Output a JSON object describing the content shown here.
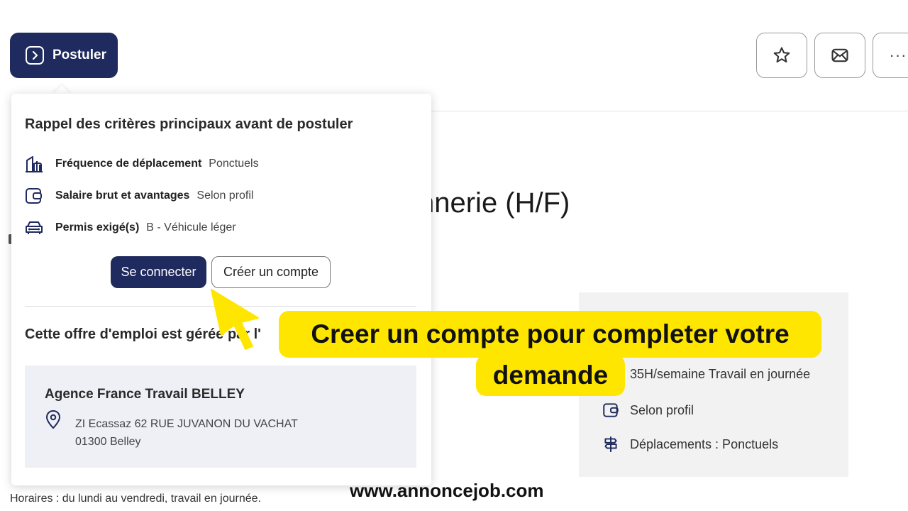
{
  "toolbar": {
    "apply_label": "Postuler",
    "favorite_icon": "star-icon",
    "mail_icon": "mail-icon",
    "more_label": "···"
  },
  "background": {
    "title_fragment": "nnerie (H/F)",
    "schedule": "35H/semaine Travail en journée",
    "salary": "Selon profil",
    "travel": "Déplacements : Ponctuels",
    "hours": "Horaires : du lundi au vendredi, travail en journée."
  },
  "popover": {
    "heading": "Rappel des critères principaux avant de postuler",
    "criteria": [
      {
        "label": "Fréquence de déplacement",
        "value": "Ponctuels",
        "icon": "building-chart-icon"
      },
      {
        "label": "Salaire brut et avantages",
        "value": "Selon profil",
        "icon": "wallet-icon"
      },
      {
        "label": "Permis exigé(s)",
        "value": "B - Véhicule léger",
        "icon": "car-icon"
      }
    ],
    "login_label": "Se connecter",
    "create_label": "Créer un compte",
    "managed_by": "Cette offre d'emploi est gérée par l'",
    "agency": {
      "name": "Agence France Travail BELLEY",
      "address_line1": "ZI Ecassaz 62 RUE JUVANON DU VACHAT",
      "address_line2": "01300 Belley"
    }
  },
  "overlay": {
    "callout_line1": "Creer un compte pour completer votre",
    "callout_line2": "demande",
    "watermark": "www.annoncejob.com"
  },
  "colors": {
    "primary": "#1f2a5e",
    "highlight": "#ffe600",
    "panel": "#eef0f6"
  }
}
